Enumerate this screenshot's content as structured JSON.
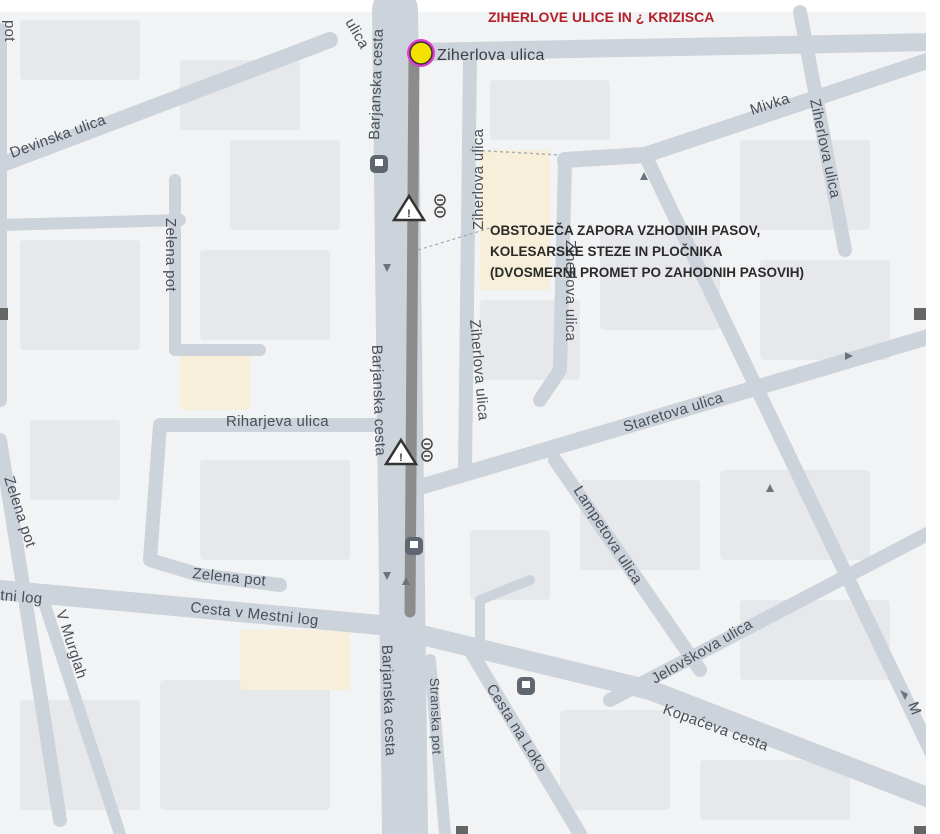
{
  "map": {
    "title": "ZIHERLOVE ULICE IN ¿ KRIZISCA",
    "marker_label": "Ziherlova ulica",
    "note_lines": [
      "OBSTOJEČA ZAPORA VZHODNIH PASOV,",
      "KOLESARSKE STEZE IN PLOČNIKA",
      "(DVOSMERNI PROMET PO ZAHODNIH PASOVIH)"
    ],
    "streets": {
      "ulica_top": "ulica",
      "pot_top": "pot",
      "barjanska_north": "Barjanska cesta",
      "barjanska_mid": "Barjanska cesta",
      "barjanska_south": "Barjanska cesta",
      "devinska": "Devinska ulica",
      "mivka": "Mivka",
      "ziherlova_right": "Ziherlova ulica",
      "ziherlova_mid": "Ziherlova ulica",
      "ziherlova_center": "Ziherlova ulica",
      "zelena_pot_north": "Zelena pot",
      "zelena_pot_west": "Zelena pot",
      "zelena_pot_south": "Zelena pot",
      "riharjeva": "Riharjeva ulica",
      "staretova": "Staretova ulica",
      "lampetova": "Lampetova ulica",
      "jeloviskova": "Jelovškova ulica",
      "kopaceva": "Kopaćeva cesta",
      "cesta_v_mestni_log": "Cesta v Mestni log",
      "mestni_log_left": "tni log",
      "v_murglah": "V Murglah",
      "stranska_pot": "Stranska pot",
      "cesta_na_loko": "Cesta na Loko",
      "edge_m": "M"
    },
    "colors": {
      "background": "#f2f3f5",
      "road": "#cdd3db",
      "closure": "#8c8c8c",
      "marker": "#f5e100",
      "marker_ring": "#e03ad0",
      "title": "#b3202a"
    },
    "icons": [
      "bus-stop-icon",
      "roadwork-warning-icon",
      "no-entry-icon",
      "location-marker-icon"
    ]
  }
}
